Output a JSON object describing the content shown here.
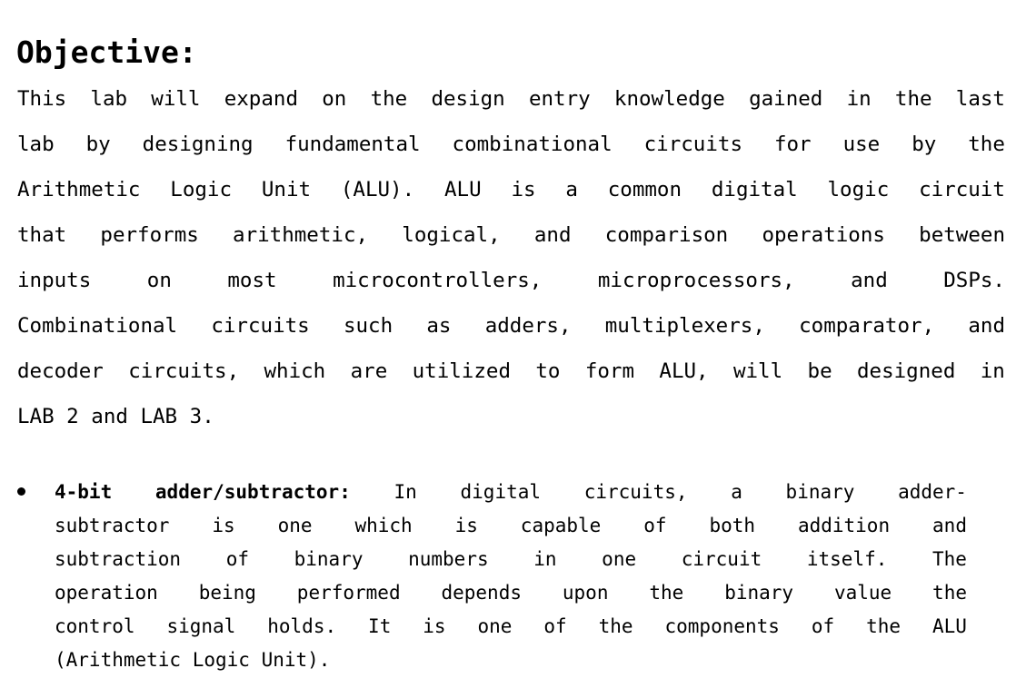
{
  "document": {
    "heading": "Objective:",
    "paragraph": {
      "text": "This lab will expand on the design entry knowledge gained in the last lab by designing fundamental combinational circuits for use by the Arithmetic Logic Unit (ALU). ALU is a common digital logic circuit that performs arithmetic, logical, and comparison operations between inputs on most microcontrollers, microprocessors, and DSPs. Combinational circuits such as adders, multiplexers, comparator, and decoder circuits, which are utilized to form ALU, will be designed in LAB 2 and LAB 3.",
      "lines": [
        {
          "words": [
            "This",
            "lab",
            "will",
            "expand",
            "on",
            "the",
            "design",
            "entry",
            "knowledge",
            "gained",
            "in",
            "the",
            "last"
          ],
          "justified": true
        },
        {
          "words": [
            "lab",
            "by",
            "designing",
            "fundamental",
            "combinational",
            "circuits",
            "for",
            "use",
            "by",
            "the"
          ],
          "justified": true
        },
        {
          "words": [
            "Arithmetic",
            "Logic",
            "Unit",
            "(ALU).",
            "ALU",
            "is",
            "a",
            "common",
            "digital",
            "logic",
            "circuit"
          ],
          "justified": true
        },
        {
          "words": [
            "that",
            "performs",
            "arithmetic,",
            "logical,",
            "and",
            "comparison",
            "operations",
            "between"
          ],
          "justified": true
        },
        {
          "words": [
            "inputs",
            "on",
            "most",
            "microcontrollers,",
            "microprocessors,",
            "and",
            "DSPs."
          ],
          "justified": true
        },
        {
          "words": [
            "Combinational",
            "circuits",
            "such",
            "as",
            "adders,",
            "multiplexers,",
            "comparator,",
            "and"
          ],
          "justified": true
        },
        {
          "words": [
            "decoder",
            "circuits,",
            "which",
            "are",
            "utilized",
            "to",
            "form",
            "ALU,",
            "will",
            "be",
            "designed",
            "in"
          ],
          "justified": true
        },
        {
          "words": [
            "LAB 2 and LAB 3."
          ],
          "justified": false
        }
      ]
    },
    "bullets": [
      {
        "marker": "bullet-dot",
        "bold_lead": "4-bit adder/subtractor:",
        "text": "4-bit adder/subtractor: In digital circuits, a binary adder-subtractor is one which is capable of both addition and subtraction of binary numbers in one circuit itself. The operation being performed depends upon the binary value the control signal holds. It is one of the components of the ALU (Arithmetic Logic Unit).",
        "lines": [
          {
            "segments": [
              {
                "text": "4-bit",
                "bold": true
              },
              {
                "text": "adder/subtractor:",
                "bold": true
              },
              {
                "text": "In",
                "bold": false
              },
              {
                "text": "digital",
                "bold": false
              },
              {
                "text": "circuits,",
                "bold": false
              },
              {
                "text": "a",
                "bold": false
              },
              {
                "text": "binary",
                "bold": false
              },
              {
                "text": "adder-",
                "bold": false
              }
            ],
            "justified": true
          },
          {
            "segments": [
              {
                "text": "subtractor",
                "bold": false
              },
              {
                "text": "is",
                "bold": false
              },
              {
                "text": "one",
                "bold": false
              },
              {
                "text": "which",
                "bold": false
              },
              {
                "text": "is",
                "bold": false
              },
              {
                "text": "capable",
                "bold": false
              },
              {
                "text": "of",
                "bold": false
              },
              {
                "text": "both",
                "bold": false
              },
              {
                "text": "addition",
                "bold": false
              },
              {
                "text": "and",
                "bold": false
              }
            ],
            "justified": true
          },
          {
            "segments": [
              {
                "text": "subtraction",
                "bold": false
              },
              {
                "text": "of",
                "bold": false
              },
              {
                "text": "binary",
                "bold": false
              },
              {
                "text": "numbers",
                "bold": false
              },
              {
                "text": "in",
                "bold": false
              },
              {
                "text": "one",
                "bold": false
              },
              {
                "text": "circuit",
                "bold": false
              },
              {
                "text": "itself.",
                "bold": false
              },
              {
                "text": "The",
                "bold": false
              }
            ],
            "justified": true
          },
          {
            "segments": [
              {
                "text": "operation",
                "bold": false
              },
              {
                "text": "being",
                "bold": false
              },
              {
                "text": "performed",
                "bold": false
              },
              {
                "text": "depends",
                "bold": false
              },
              {
                "text": "upon",
                "bold": false
              },
              {
                "text": "the",
                "bold": false
              },
              {
                "text": "binary",
                "bold": false
              },
              {
                "text": "value",
                "bold": false
              },
              {
                "text": "the",
                "bold": false
              }
            ],
            "justified": true
          },
          {
            "segments": [
              {
                "text": "control",
                "bold": false
              },
              {
                "text": "signal",
                "bold": false
              },
              {
                "text": "holds.",
                "bold": false
              },
              {
                "text": "It",
                "bold": false
              },
              {
                "text": "is",
                "bold": false
              },
              {
                "text": "one",
                "bold": false
              },
              {
                "text": "of",
                "bold": false
              },
              {
                "text": "the",
                "bold": false
              },
              {
                "text": "components",
                "bold": false
              },
              {
                "text": "of",
                "bold": false
              },
              {
                "text": "the",
                "bold": false
              },
              {
                "text": "ALU",
                "bold": false
              }
            ],
            "justified": true
          },
          {
            "segments": [
              {
                "text": "(Arithmetic Logic Unit).",
                "bold": false
              }
            ],
            "justified": false
          }
        ]
      }
    ],
    "colors": {
      "text": "#000000",
      "background": "#ffffff"
    }
  }
}
